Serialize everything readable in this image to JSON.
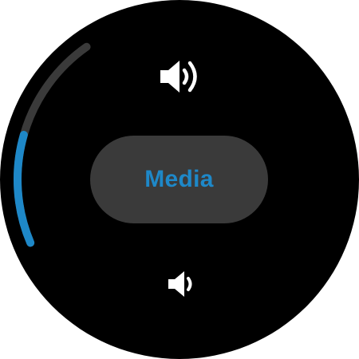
{
  "volume": {
    "stream_label": "Media",
    "level": 0.5
  },
  "controls": {
    "volume_up_icon": "volume-up-icon",
    "volume_down_icon": "volume-down-icon"
  },
  "colors": {
    "background": "#000000",
    "pill": "#3a3a3a",
    "accent": "#1e88c8",
    "track": "#3a3a3a",
    "icon": "#ffffff"
  }
}
